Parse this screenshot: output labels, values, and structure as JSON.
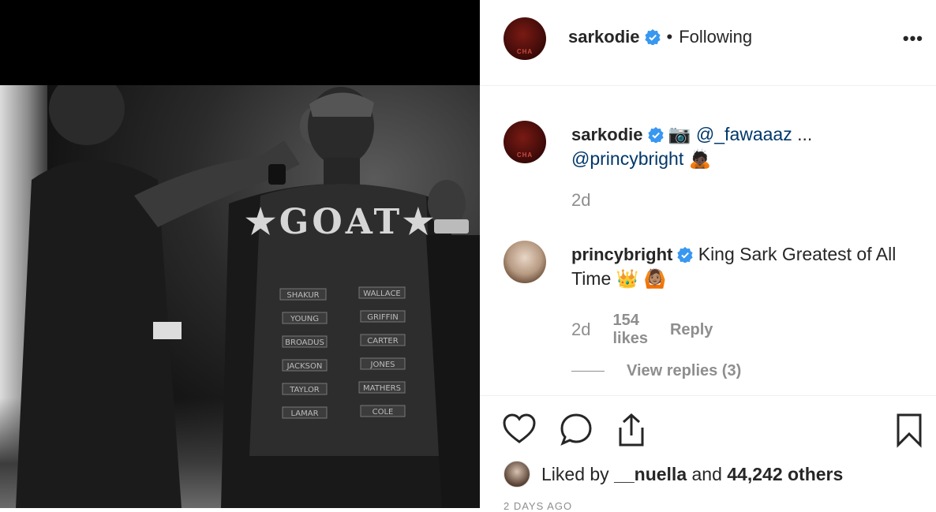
{
  "post": {
    "author": "sarkodie",
    "follow_status": "Following",
    "more_label": "•••",
    "caption": {
      "username": "sarkodie",
      "camera_emoji": "📷",
      "mention_1": "@_fawaaaz",
      "ellipsis": "...",
      "mention_2": "@princybright",
      "emoji": "🙇🏿",
      "time": "2d"
    },
    "comment": {
      "username": "princybright",
      "text": "King Sark Greatest of All Time",
      "emoji_1": "👑",
      "emoji_2": "🙆🏽",
      "time": "2d",
      "likes": "154 likes",
      "reply_label": "Reply",
      "view_replies": "View replies (3)"
    },
    "liked_by": {
      "prefix": "Liked by",
      "user": "__nuella",
      "middle": "and",
      "others": "44,242 others"
    },
    "date": "2 DAYS AGO"
  },
  "photo": {
    "jacket_text": "GOAT",
    "names_left": [
      "SHAKUR",
      "YOUNG",
      "BROADUS",
      "JACKSON",
      "TAYLOR",
      "LAMAR"
    ],
    "names_right": [
      "WALLACE",
      "GRIFFIN",
      "CARTER",
      "JONES",
      "MATHERS",
      "COLE"
    ]
  },
  "icons": [
    "verified-badge",
    "camera",
    "heart",
    "comment-bubble",
    "share",
    "bookmark"
  ],
  "colors": {
    "link": "#00376b",
    "verified": "#3897f0",
    "muted": "#8e8e8e",
    "text": "#262626"
  }
}
